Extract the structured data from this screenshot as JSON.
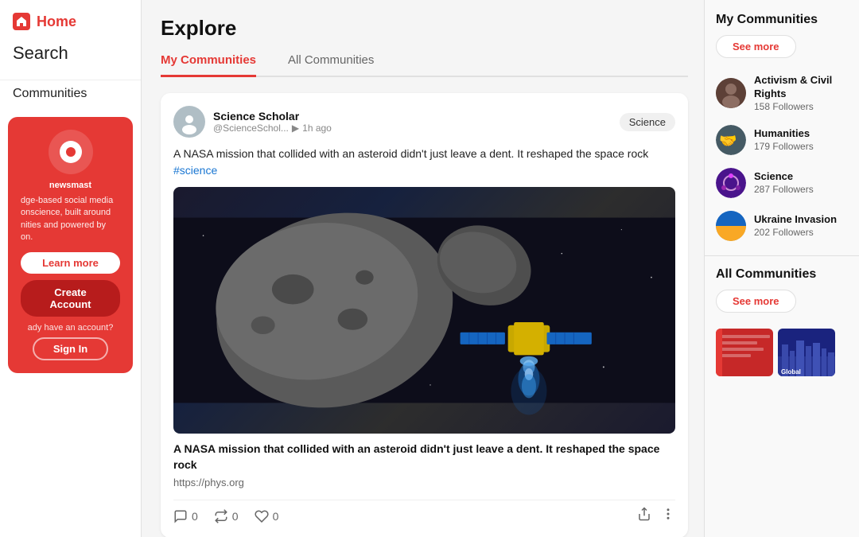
{
  "sidebar": {
    "home_label": "Home",
    "search_label": "Search",
    "communities_label": "Communities",
    "promo": {
      "brand": "newsmast",
      "description": "dge-based social media onscience, built around nities and powered by on.",
      "learn_more": "Learn more",
      "create_account": "Create Account",
      "already_text": "ady have an account?",
      "sign_in": "Sign In"
    }
  },
  "main": {
    "title": "Explore",
    "tabs": [
      {
        "id": "my-communities",
        "label": "My Communities",
        "active": true
      },
      {
        "id": "all-communities",
        "label": "All Communities",
        "active": false
      }
    ],
    "post": {
      "author_name": "Science Scholar",
      "author_handle": "@ScienceSchol...",
      "author_time": "1h ago",
      "community": "Science",
      "text": "A NASA mission that collided with an asteroid didn't just leave a dent. It reshaped the space rock",
      "tag": "#science",
      "caption": "A NASA mission that collided with an asteroid didn't just leave a dent. It reshaped the space rock",
      "link": "https://phys.org",
      "comments": 0,
      "reposts": 0,
      "likes": 0
    }
  },
  "right_sidebar": {
    "my_communities_title": "My Communities",
    "see_more_label": "See more",
    "communities": [
      {
        "id": "activism",
        "name": "Activism & Civil Rights",
        "followers": "158 Followers",
        "color": "#5d4037"
      },
      {
        "id": "humanities",
        "name": "Humanities",
        "followers": "179 Followers",
        "color": "#455a64"
      },
      {
        "id": "science",
        "name": "Science",
        "followers": "287 Followers",
        "color": "#6a1b9a"
      },
      {
        "id": "ukraine",
        "name": "Ukraine Invasion",
        "followers": "202 Followers",
        "color": "#1565c0"
      }
    ],
    "all_communities_title": "All Communities",
    "all_see_more": "See more",
    "thumb_labels": [
      "",
      "Global"
    ]
  },
  "icons": {
    "comment": "💬",
    "repost": "🔁",
    "like": "🤍",
    "share": "↗",
    "more": "⋯",
    "home": "⌂"
  }
}
